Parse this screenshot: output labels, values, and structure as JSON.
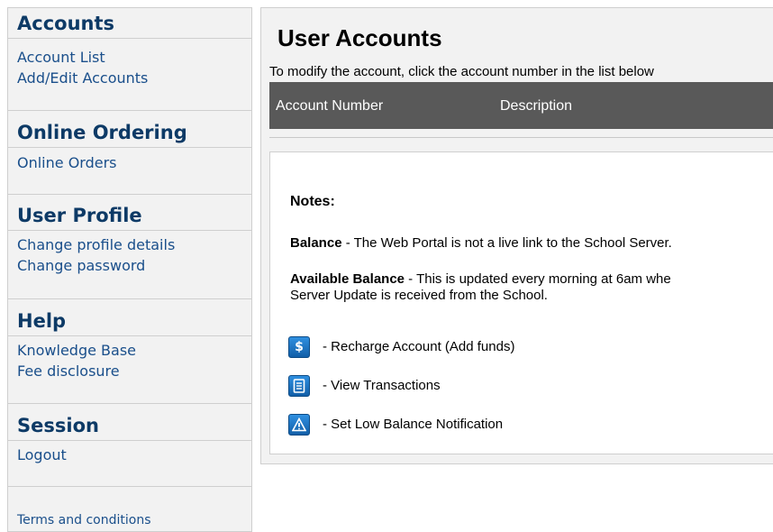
{
  "sidebar": {
    "accounts": {
      "title": "Accounts",
      "links": [
        "Account List",
        "Add/Edit Accounts"
      ]
    },
    "ordering": {
      "title": "Online Ordering",
      "links": [
        "Online Orders"
      ]
    },
    "profile": {
      "title": "User Profile",
      "links": [
        "Change profile details",
        "Change password"
      ]
    },
    "help": {
      "title": "Help",
      "links": [
        "Knowledge Base",
        "Fee disclosure"
      ]
    },
    "session": {
      "title": "Session",
      "links": [
        "Logout"
      ]
    },
    "terms": "Terms and conditions"
  },
  "main": {
    "title": "User Accounts",
    "instruction": "To modify the account, click the account number in the list below",
    "columns": [
      "Account Number",
      "Description"
    ],
    "notes": {
      "heading": "Notes:",
      "balance_label": "Balance",
      "balance_text": " - The Web Portal is not a live link to the School Server.",
      "available_label": "Available Balance",
      "available_text": " - This is updated every morning at 6am whe",
      "available_text2": "Server Update is received from the School.",
      "legend": [
        {
          "icon": "dollar-icon",
          "label": "-  Recharge Account (Add funds)"
        },
        {
          "icon": "document-icon",
          "label": "-  View Transactions"
        },
        {
          "icon": "warning-icon",
          "label": "-  Set Low Balance Notification"
        }
      ]
    }
  }
}
